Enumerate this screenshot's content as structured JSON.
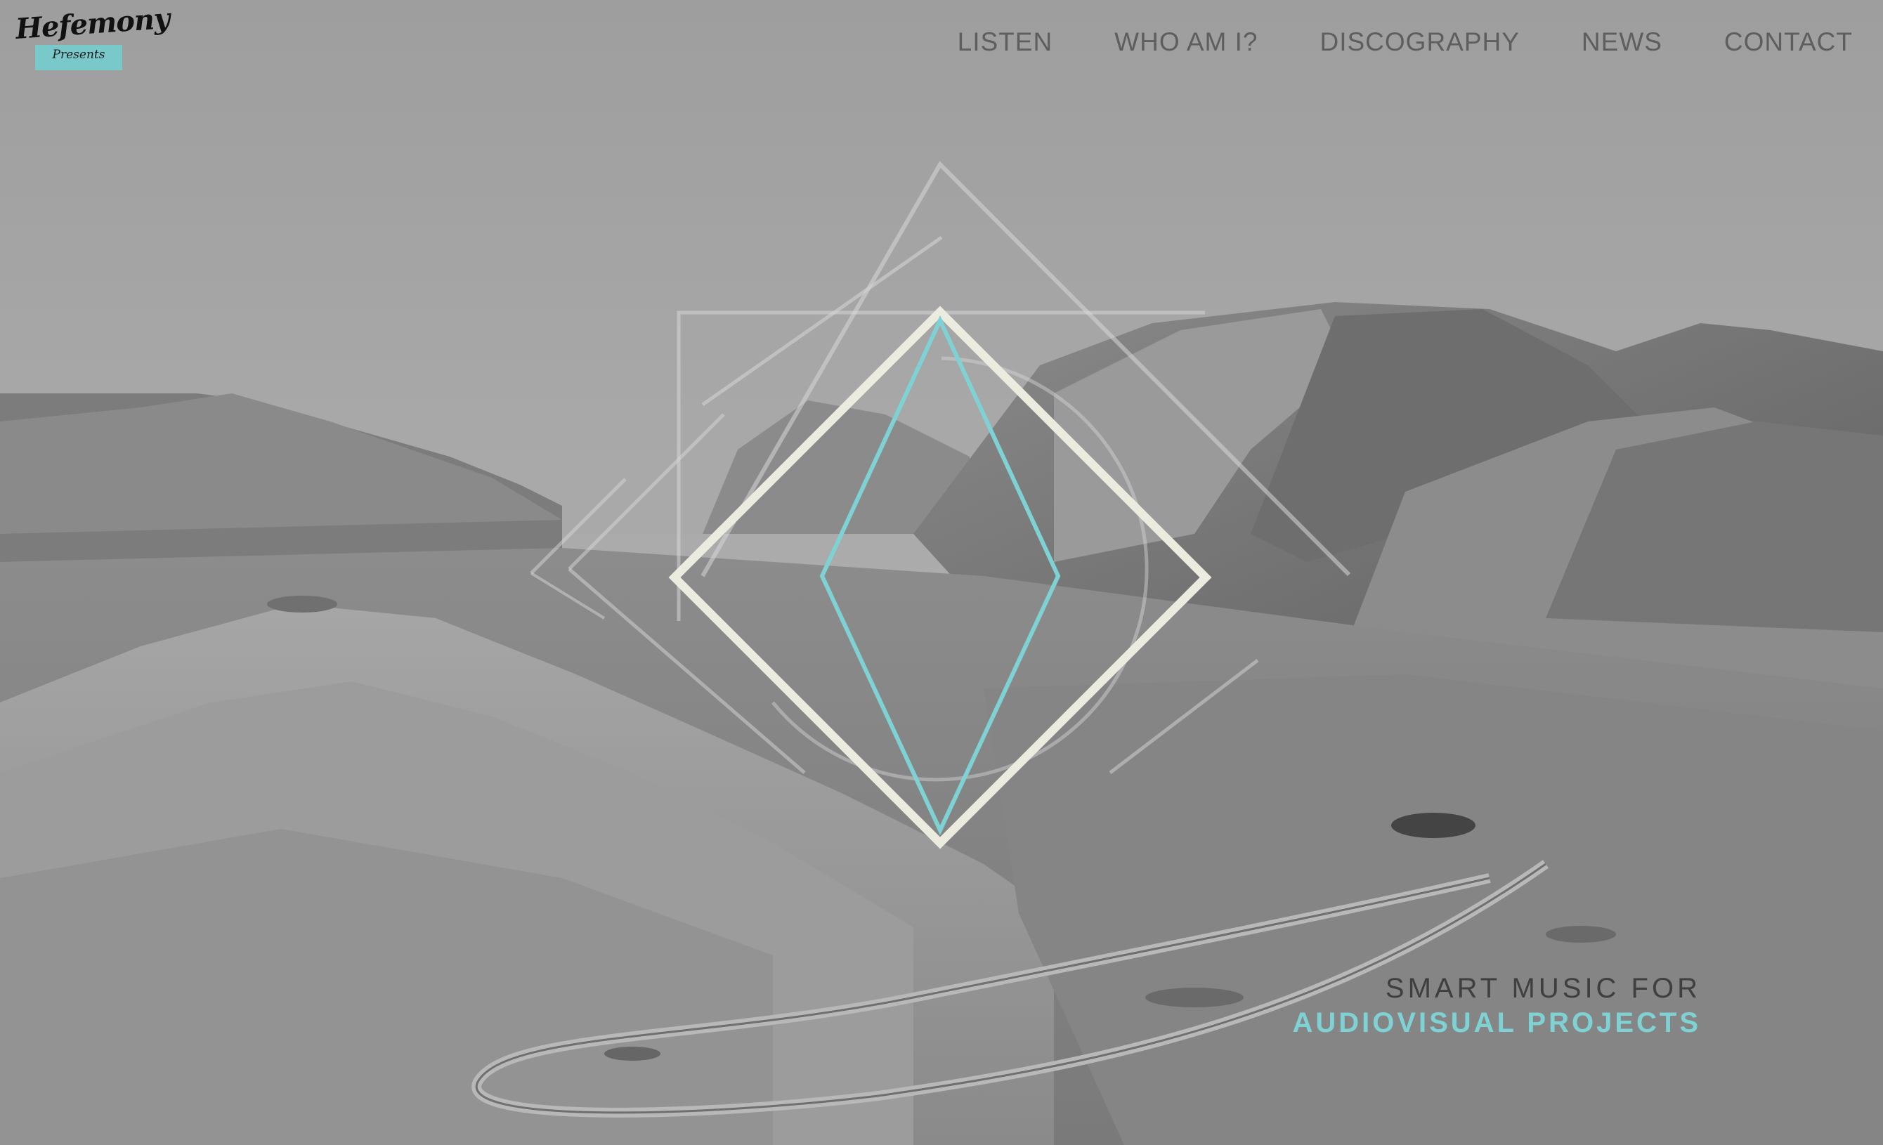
{
  "site": {
    "logo": {
      "wordmark": "Hefemony",
      "subtitle": "Presents"
    },
    "nav": {
      "items": [
        "LISTEN",
        "WHO AM I?",
        "DISCOGRAPHY",
        "NEWS",
        "CONTACT"
      ]
    },
    "hero": {
      "background": "grayscale photo of volcanic mountains and a winding road",
      "tagline_line1": "SMART MUSIC FOR",
      "tagline_line2": "AUDIOVISUAL PROJECTS"
    }
  },
  "colors": {
    "accent": "#7fd2d4",
    "nav_text": "#5e5e5e",
    "emblem_cream": "#ecebdf"
  }
}
